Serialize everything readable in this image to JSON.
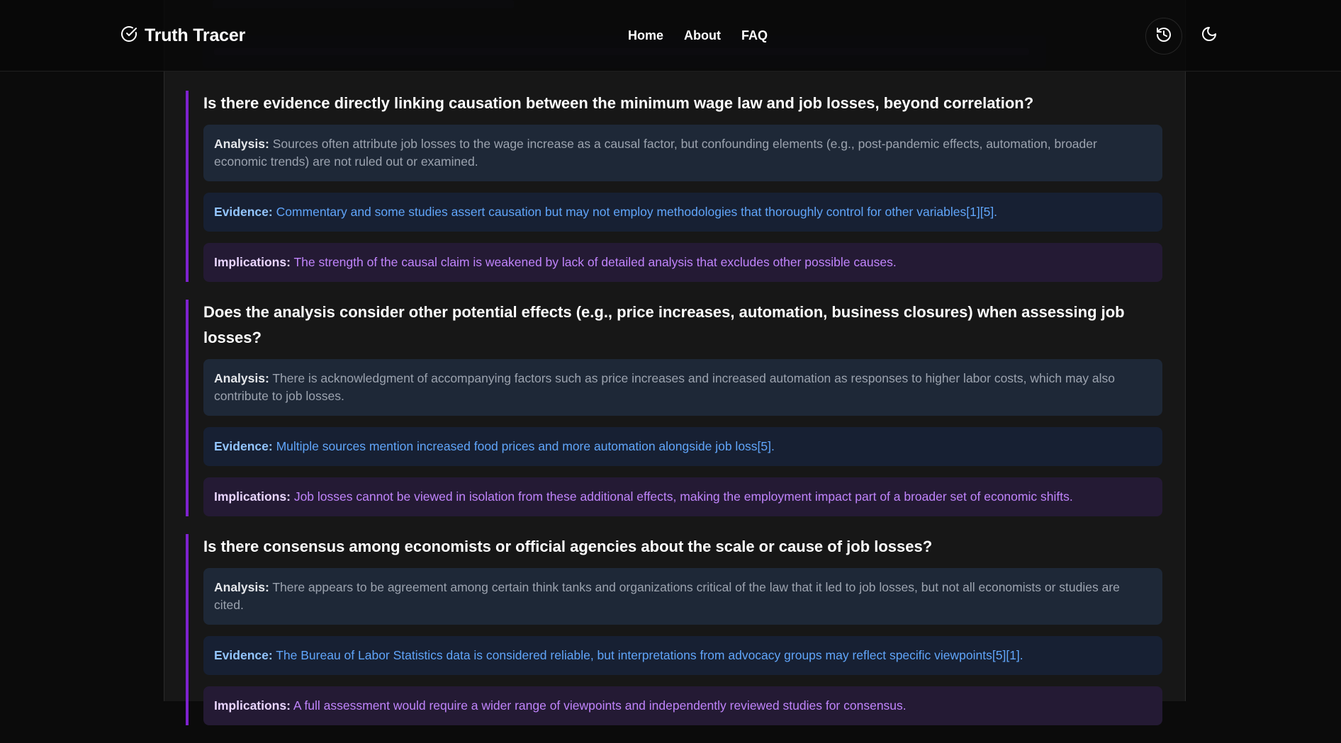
{
  "header": {
    "app_name": "Truth Tracer",
    "nav": [
      "Home",
      "About",
      "FAQ"
    ],
    "icons": {
      "logo": "check-circle-icon",
      "history": "history-icon",
      "theme": "moon-icon"
    }
  },
  "colors": {
    "accent": "#7e22ce",
    "evidence": "#60a5fa",
    "implications": "#c084fc"
  },
  "sections": [
    {
      "question": "Is there evidence directly linking causation between the minimum wage law and job losses, beyond correlation?",
      "analysis_label": "Analysis:",
      "analysis": "Sources often attribute job losses to the wage increase as a causal factor, but confounding elements (e.g., post-pandemic effects, automation, broader economic trends) are not ruled out or examined.",
      "evidence_label": "Evidence:",
      "evidence": "Commentary and some studies assert causation but may not employ methodologies that thoroughly control for other variables[1][5].",
      "implications_label": "Implications:",
      "implications": "The strength of the causal claim is weakened by lack of detailed analysis that excludes other possible causes."
    },
    {
      "question": "Does the analysis consider other potential effects (e.g., price increases, automation, business closures) when assessing job losses?",
      "analysis_label": "Analysis:",
      "analysis": "There is acknowledgment of accompanying factors such as price increases and increased automation as responses to higher labor costs, which may also contribute to job losses.",
      "evidence_label": "Evidence:",
      "evidence": "Multiple sources mention increased food prices and more automation alongside job loss[5].",
      "implications_label": "Implications:",
      "implications": "Job losses cannot be viewed in isolation from these additional effects, making the employment impact part of a broader set of economic shifts."
    },
    {
      "question": "Is there consensus among economists or official agencies about the scale or cause of job losses?",
      "analysis_label": "Analysis:",
      "analysis": "There appears to be agreement among certain think tanks and organizations critical of the law that it led to job losses, but not all economists or studies are cited.",
      "evidence_label": "Evidence:",
      "evidence": "The Bureau of Labor Statistics data is considered reliable, but interpretations from advocacy groups may reflect specific viewpoints[5][1].",
      "implications_label": "Implications:",
      "implications": "A full assessment would require a wider range of viewpoints and independently reviewed studies for consensus."
    }
  ]
}
